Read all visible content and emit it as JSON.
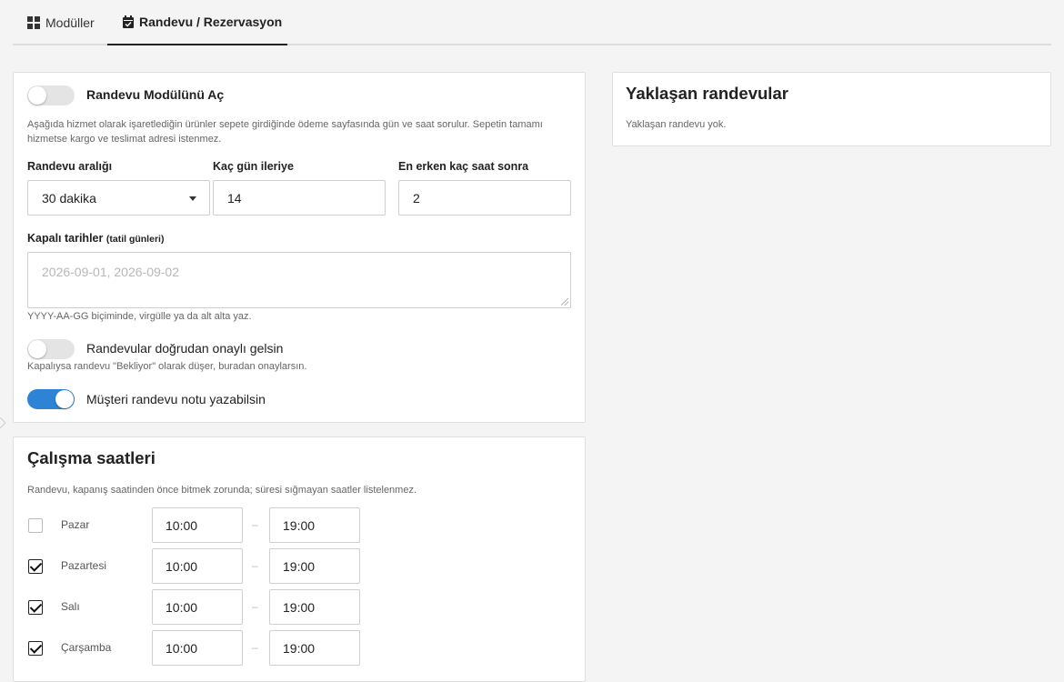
{
  "tabs": [
    {
      "label": "Modüller",
      "icon": "grid-icon"
    },
    {
      "label": "Randevu / Rezervasyon",
      "icon": "calendar-check-icon",
      "active": true
    }
  ],
  "settings": {
    "enable_label": "Randevu Modülünü Aç",
    "enable_on": false,
    "description": "Aşağıda hizmet olarak işaretlediğin ürünler sepete girdiğinde ödeme sayfasında gün ve saat sorulur. Sepetin tamamı hizmetse kargo ve teslimat adresi istenmez.",
    "interval_label": "Randevu aralığı",
    "interval_value": "30 dakika",
    "days_ahead_label": "Kaç gün ileriye",
    "days_ahead_value": "14",
    "min_hours_label": "En erken kaç saat sonra",
    "min_hours_value": "2",
    "closed_dates_label": "Kapalı tarihler",
    "closed_dates_sub": "(tatil günleri)",
    "closed_dates_placeholder": "2026-09-01, 2026-09-02",
    "closed_dates_help": "YYYY-AA-GG biçiminde, virgülle ya da alt alta yaz.",
    "auto_confirm_label": "Randevular doğrudan onaylı gelsin",
    "auto_confirm_on": false,
    "auto_confirm_help": "Kapalıysa randevu \"Bekliyor\" olarak düşer, buradan onaylarsın.",
    "customer_note_label": "Müşteri randevu notu yazabilsin",
    "customer_note_on": true
  },
  "upcoming": {
    "title": "Yaklaşan randevular",
    "empty_text": "Yaklaşan randevu yok."
  },
  "hours": {
    "title": "Çalışma saatleri",
    "description": "Randevu, kapanış saatinden önce bitmek zorunda; süresi sığmayan saatler listelenmez.",
    "separator": "–",
    "days": [
      {
        "name": "Pazar",
        "checked": false,
        "open": "10:00",
        "close": "19:00"
      },
      {
        "name": "Pazartesi",
        "checked": true,
        "open": "10:00",
        "close": "19:00"
      },
      {
        "name": "Salı",
        "checked": true,
        "open": "10:00",
        "close": "19:00"
      },
      {
        "name": "Çarşamba",
        "checked": true,
        "open": "10:00",
        "close": "19:00"
      }
    ]
  },
  "colors": {
    "accent": "#2d84d6",
    "background": "#f4f4f4"
  }
}
